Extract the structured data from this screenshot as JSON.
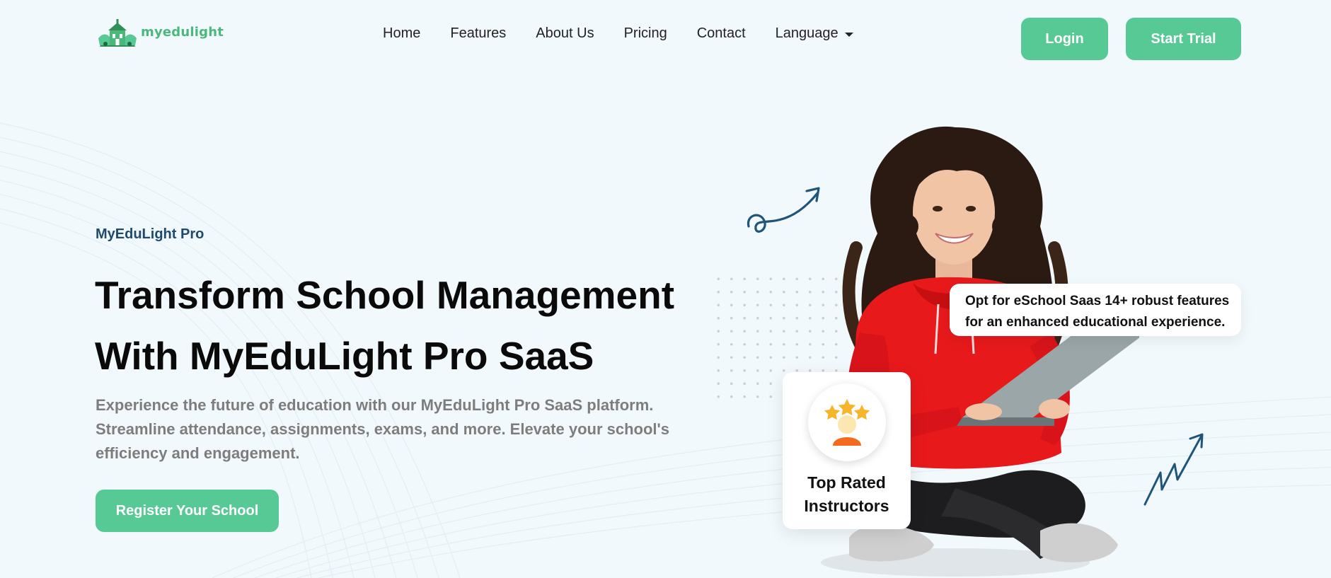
{
  "header": {
    "logo_text": "myedulight",
    "nav": [
      {
        "label": "Home"
      },
      {
        "label": "Features"
      },
      {
        "label": "About Us"
      },
      {
        "label": "Pricing"
      },
      {
        "label": "Contact"
      },
      {
        "label": "Language"
      }
    ],
    "login_label": "Login",
    "trial_label": "Start Trial"
  },
  "hero": {
    "eyebrow": "MyEduLight Pro",
    "title_lines": [
      "Transform School Management",
      "With MyEduLight Pro SaaS"
    ],
    "description_lines": [
      "Experience the future of education with our MyEduLight Pro SaaS platform.",
      "Streamline attendance, assignments, exams, and more. Elevate your school's",
      "efficiency and engagement."
    ],
    "register_label": "Register Your School"
  },
  "feature_bubble": {
    "lines": [
      "Opt for eSchool Saas 14+ robust features",
      "for an enhanced educational experience."
    ]
  },
  "rated_card": {
    "lines": [
      "Top Rated",
      "Instructors"
    ]
  },
  "colors": {
    "accent": "#57c994",
    "page_bg": "#f2f9fd",
    "eyebrow": "#1f4a6e",
    "hoodie": "#e8191b"
  },
  "icons": {
    "logo": "school-building-logo",
    "language": "chevron-down-icon",
    "arrow_top": "swirl-arrow-icon",
    "arrow_bottom": "zigzag-arrow-icon",
    "badge": "star-award-icon"
  }
}
